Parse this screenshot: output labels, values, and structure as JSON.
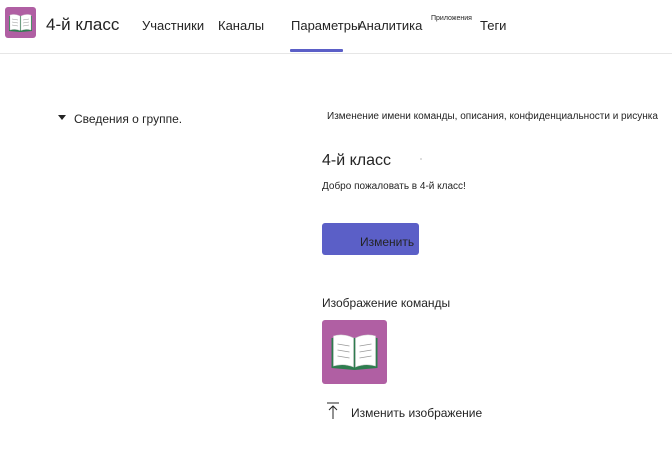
{
  "team": {
    "name": "4-й класс"
  },
  "tabs": [
    {
      "label": "Участники"
    },
    {
      "label": "Каналы"
    },
    {
      "label": "Параметры",
      "active": true
    },
    {
      "label": "Аналитика"
    },
    {
      "label": "Приложения"
    },
    {
      "label": "Теги"
    }
  ],
  "accent_color": "#5b5fc7",
  "avatar_color": "#b05fa3",
  "sidebar": {
    "section_label": "Сведения о группе."
  },
  "details": {
    "description": "Изменение имени команды, описания, конфиденциальности и рисунка",
    "group_title": "4-й класс",
    "welcome_text": "Добро пожаловать в 4-й класс!",
    "edit_button": "Изменить",
    "image_label": "Изображение команды",
    "change_image": "Изменить изображение"
  }
}
